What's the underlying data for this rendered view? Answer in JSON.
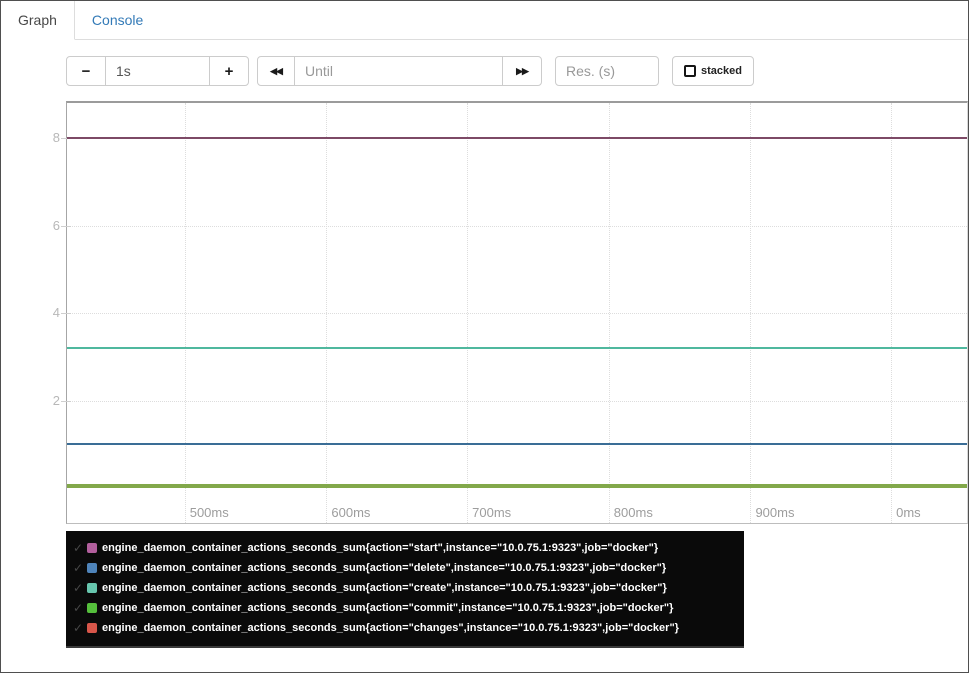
{
  "tabs": {
    "graph": "Graph",
    "console": "Console"
  },
  "toolbar": {
    "decrease_label": "−",
    "range_value": "1s",
    "increase_label": "+",
    "rewind_icon": "◀◀",
    "until_placeholder": "Until",
    "forward_icon": "▶▶",
    "res_placeholder": "Res. (s)",
    "stacked_label": "stacked",
    "stacked_checked": false
  },
  "legend": {
    "check_icon": "✓"
  },
  "chart_data": {
    "type": "line",
    "title": "",
    "xlabel": "",
    "ylabel": "",
    "ylim": [
      0,
      8.8
    ],
    "grid": true,
    "legend_position": "bottom",
    "y_ticks": [
      8,
      6,
      4,
      2
    ],
    "x_ticks": [
      {
        "label": "500ms",
        "pos": 0.1308
      },
      {
        "label": "600ms",
        "pos": 0.2882
      },
      {
        "label": "700ms",
        "pos": 0.4446
      },
      {
        "label": "800ms",
        "pos": 0.602
      },
      {
        "label": "900ms",
        "pos": 0.7594
      },
      {
        "label": "0ms",
        "pos": 0.9157
      }
    ],
    "series": [
      {
        "name": "engine_daemon_container_actions_seconds_sum{action=\"start\",instance=\"10.0.75.1:9323\",job=\"docker\"}",
        "action": "start",
        "value": 8,
        "swatch_color": "#b25f9d",
        "line_color": "#7d4a66",
        "line_width": 2
      },
      {
        "name": "engine_daemon_container_actions_seconds_sum{action=\"delete\",instance=\"10.0.75.1:9323\",job=\"docker\"}",
        "action": "delete",
        "value": 1,
        "swatch_color": "#4f84ba",
        "line_color": "#3a6d96",
        "line_width": 2
      },
      {
        "name": "engine_daemon_container_actions_seconds_sum{action=\"create\",instance=\"10.0.75.1:9323\",job=\"docker\"}",
        "action": "create",
        "value": 3.2,
        "swatch_color": "#67c6ae",
        "line_color": "#4fb89e",
        "line_width": 2
      },
      {
        "name": "engine_daemon_container_actions_seconds_sum{action=\"commit\",instance=\"10.0.75.1:9323\",job=\"docker\"}",
        "action": "commit",
        "value": 0.05,
        "swatch_color": "#55bf3c",
        "line_color": "#82a84a",
        "line_width": 4
      },
      {
        "name": "engine_daemon_container_actions_seconds_sum{action=\"changes\",instance=\"10.0.75.1:9323\",job=\"docker\"}",
        "action": "changes",
        "value": 0.05,
        "swatch_color": "#d8564a",
        "line_color": "#d8564a",
        "line_width": 3
      }
    ]
  }
}
